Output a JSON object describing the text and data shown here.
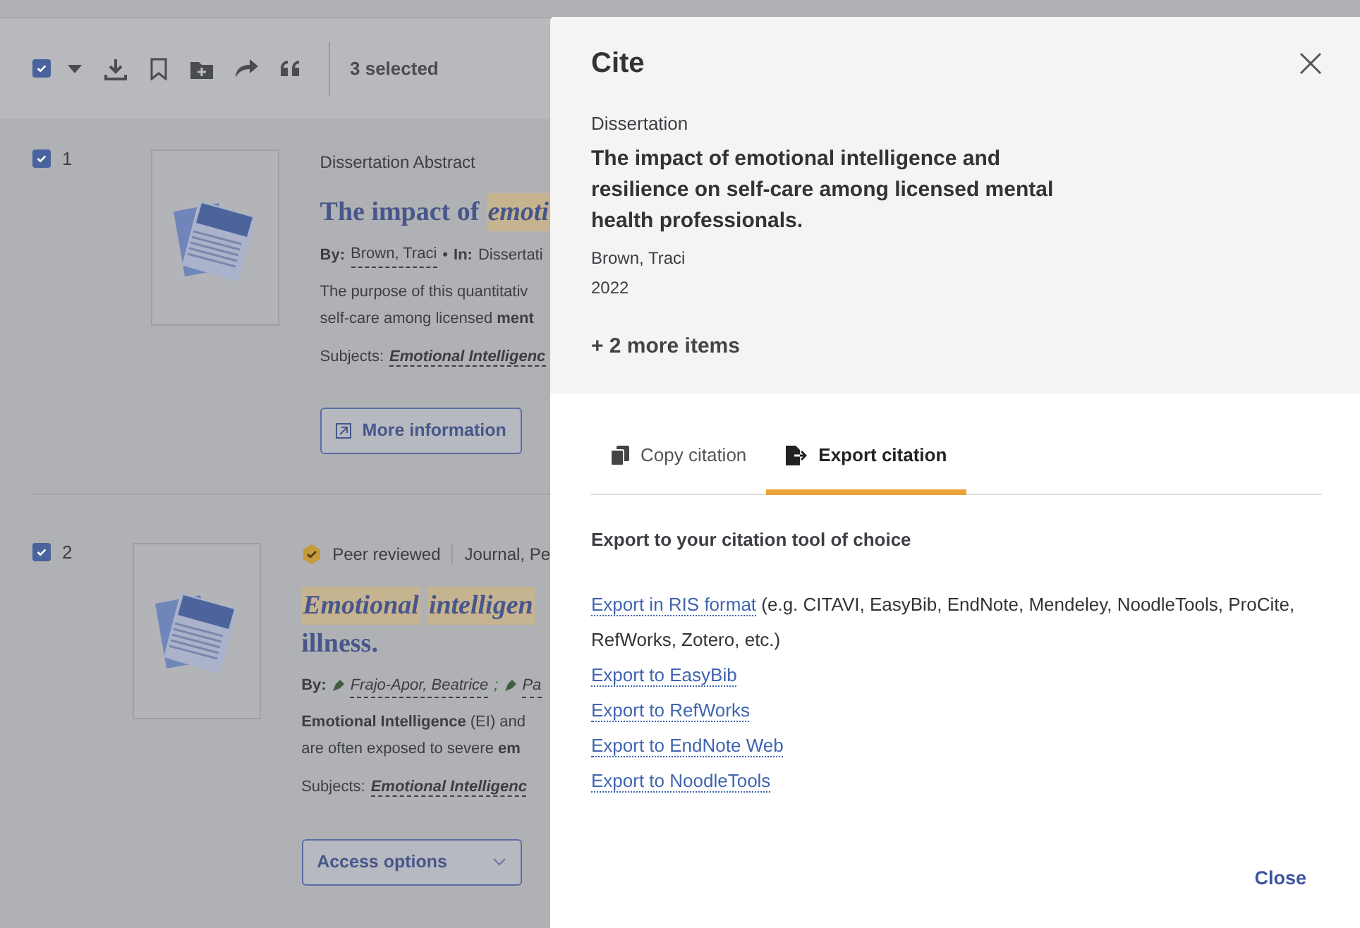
{
  "toolbar": {
    "checked": true,
    "selected_count": "3 selected"
  },
  "results": [
    {
      "number": "1",
      "checked": true,
      "kind": "dissertation",
      "meta": {
        "type": "Dissertation Abstract"
      },
      "title_lines": [
        [
          {
            "text": "The impact of",
            "highlight": false
          },
          {
            "text": "emoti",
            "highlight": true
          }
        ]
      ],
      "by_label": "By:",
      "authors": [
        "Brown, Traci"
      ],
      "bullet": "•",
      "source_label": "In:",
      "source": "Dissertati",
      "abstract": [
        "The purpose of this quantitativ",
        "self-care among licensed **ment**"
      ],
      "subjects_label": "Subjects:",
      "subjects": "Emotional Intelligenc",
      "button": {
        "kind": "info",
        "label": "More information"
      }
    },
    {
      "number": "2",
      "checked": true,
      "kind": "article",
      "meta": {
        "badge": "Peer reviewed",
        "type": "Journal, Pe"
      },
      "title_lines": [
        [
          {
            "text": "Emotional",
            "highlight": true
          },
          {
            "text": "intelligen",
            "highlight": true
          }
        ],
        [
          {
            "text": "illness.",
            "highlight": false
          }
        ]
      ],
      "by_label": "By:",
      "authors": [
        "Frajo-Apor, Beatrice",
        "Pa"
      ],
      "author_separator": ";",
      "abstract": [
        "**Emotional Intelligence** (EI) and",
        "are often exposed to severe **em**"
      ],
      "subjects_label": "Subjects:",
      "subjects": "Emotional Intelligenc",
      "button": {
        "kind": "dropdown",
        "label": "Access options"
      }
    }
  ],
  "modal": {
    "title": "Cite",
    "item": {
      "type": "Dissertation",
      "title": "The impact of emotional intelligence and resilience on self-care among licensed mental health professionals.",
      "author": "Brown, Traci",
      "year": "2022"
    },
    "more_items": "+ 2 more items",
    "tabs": [
      {
        "label": "Copy citation",
        "kind": "copy",
        "selected": false
      },
      {
        "label": "Export citation",
        "kind": "export",
        "selected": true
      }
    ],
    "heading": "Export to your citation tool of choice",
    "links": [
      {
        "label": "Export in RIS format",
        "note": "(e.g. CITAVI, EasyBib, EndNote, Mendeley, NoodleTools, ProCite, RefWorks, Zotero, etc.)"
      },
      {
        "label": "Export to EasyBib"
      },
      {
        "label": "Export to RefWorks"
      },
      {
        "label": "Export to EndNote Web"
      },
      {
        "label": "Export to NoodleTools"
      }
    ],
    "close_button": "Close"
  }
}
